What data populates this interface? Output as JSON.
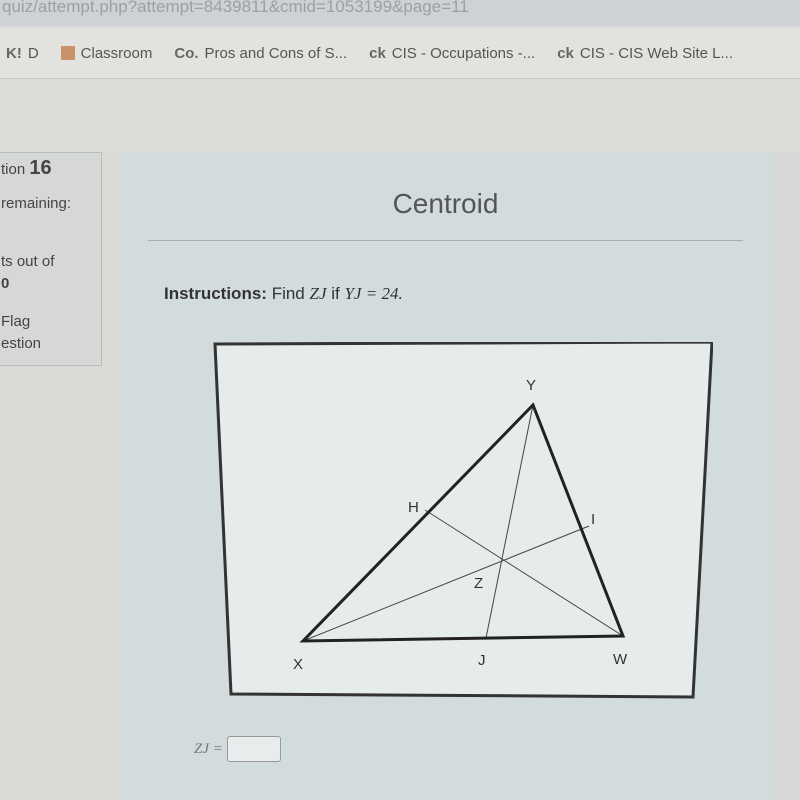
{
  "browser": {
    "url": "quiz/attempt.php?attempt=8439811&cmid=1053199&page=11",
    "bookmarks": [
      {
        "icon": "K!",
        "label": "D"
      },
      {
        "icon": "classroom-icon",
        "label": "Classroom"
      },
      {
        "icon": "Co.",
        "label": "Pros and Cons of S..."
      },
      {
        "icon": "ck",
        "label": "CIS - Occupations -..."
      },
      {
        "icon": "ck",
        "label": "CIS - CIS Web Site L..."
      }
    ]
  },
  "sidebar": {
    "question_label": "tion",
    "question_number": "16",
    "time": "remaining:",
    "points": "ts out of",
    "points_value": "0",
    "flag": "Flag",
    "flag2": "estion"
  },
  "question": {
    "title": "Centroid",
    "instructions_label": "Instructions:",
    "instructions_text": "Find",
    "var1": "ZJ",
    "if": "if",
    "expr": "YJ = 24."
  },
  "figure": {
    "labels": {
      "Y": "Y",
      "H": "H",
      "I": "I",
      "Z": "Z",
      "X": "X",
      "J": "J",
      "W": "W"
    }
  },
  "answer": {
    "label": "ZJ =",
    "value": ""
  }
}
